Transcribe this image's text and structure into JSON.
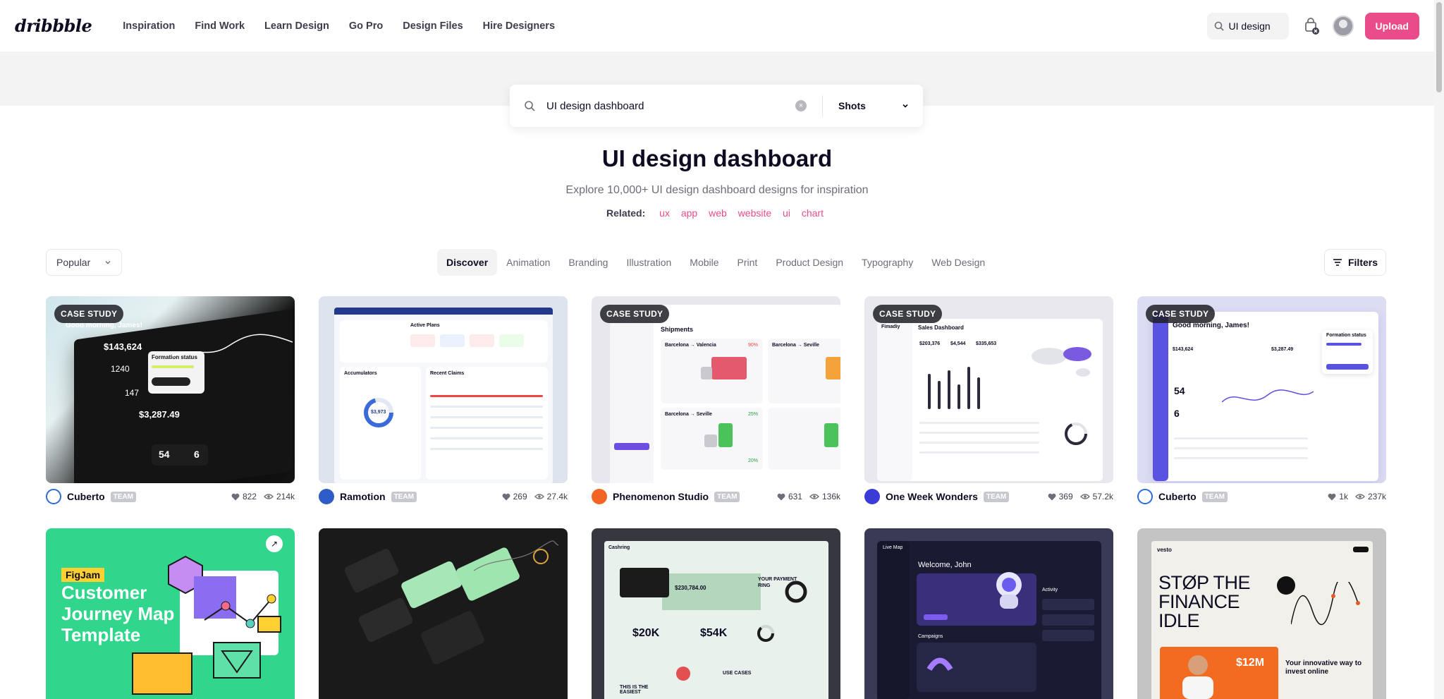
{
  "nav": {
    "logo": "dribbble",
    "links": [
      "Inspiration",
      "Find Work",
      "Learn Design",
      "Go Pro",
      "Design Files",
      "Hire Designers"
    ],
    "search_value": "UI design",
    "upload_label": "Upload"
  },
  "search": {
    "value": "UI design dashboard",
    "type": "Shots"
  },
  "hero": {
    "title": "UI design dashboard",
    "subtitle": "Explore 10,000+ UI design dashboard designs for inspiration",
    "related_label": "Related:",
    "related": [
      "ux",
      "app",
      "web",
      "website",
      "ui",
      "chart"
    ]
  },
  "filters": {
    "sort": "Popular",
    "categories": [
      "Discover",
      "Animation",
      "Branding",
      "Illustration",
      "Mobile",
      "Print",
      "Product Design",
      "Typography",
      "Web Design"
    ],
    "active": "Discover",
    "filters_label": "Filters"
  },
  "shots": [
    {
      "author": "Cuberto",
      "badge": "CASE STUDY",
      "team": "TEAM",
      "likes": "822",
      "views": "214k",
      "avatar_color": "#2f6bd8"
    },
    {
      "author": "Ramotion",
      "badge": "",
      "team": "TEAM",
      "likes": "269",
      "views": "27.4k",
      "avatar_color": "#2e5cc9"
    },
    {
      "author": "Phenomenon Studio",
      "badge": "CASE STUDY",
      "team": "TEAM",
      "likes": "631",
      "views": "136k",
      "avatar_color": "#f26522"
    },
    {
      "author": "One Week Wonders",
      "badge": "CASE STUDY",
      "team": "TEAM",
      "likes": "369",
      "views": "57.2k",
      "avatar_color": "#3b3bd6"
    },
    {
      "author": "Cuberto",
      "badge": "CASE STUDY",
      "team": "TEAM",
      "likes": "1k",
      "views": "237k",
      "avatar_color": "#2f6bd8"
    }
  ],
  "row2": {
    "figjam_label": "FigJam",
    "figjam_title": "Customer Journey Map Template",
    "finance_headline": "STØP THE FINANCE IDLE",
    "finance_amount": "$12M",
    "finance_tag": "Your innovative way to invest online",
    "finance_brand": "vesto",
    "dash_amount": "$230,784.00",
    "dash_stat1": "$20K",
    "dash_stat2": "$54K",
    "dash_ring": "YOUR PAYMENT RING",
    "dash_usecases": "USE CASES",
    "dash_easiest": "THIS IS THE EASIEST",
    "dash_brand": "Cashring",
    "welcome": "Welcome, John",
    "live_map": "Live Map",
    "activity": "Activity",
    "campaigns": "Campaigns"
  },
  "thumb_text": {
    "t1_greet": "Good morning, James!",
    "t1_amount": "$143,624",
    "t1_n1": "1240",
    "t1_n2": "147",
    "t1_amount2": "$3,287.49",
    "t1_clients": "54",
    "t1_invoices": "6",
    "t1_status": "Formation status",
    "t2_title": "Active Plans",
    "t2_sub": "Accumulators",
    "t2_claims": "Recent Claims",
    "t2_ring": "$3,973",
    "t3_title": "Shipments",
    "t3_r1": "Barcelona → Valencia",
    "t3_r2": "Barcelona → Seville",
    "t3_pct1": "90%",
    "t3_pct2": "25%",
    "t3_pct3": "20%",
    "t4_title": "Sales Dashboard",
    "t4_brand": "Fimadiy",
    "t4_a": "$203,376",
    "t4_b": "$4,544",
    "t4_c": "$335,653",
    "t5_greet": "Good morning, James!",
    "t5_status": "Formation status",
    "t5_clients": "54",
    "t5_invoices": "6",
    "t5_amount": "$143,624",
    "t5_amount2": "$3,287.49"
  },
  "colors": {
    "accent": "#ea4c89",
    "text": "#0d0c22",
    "muted": "#6e6d7a"
  }
}
